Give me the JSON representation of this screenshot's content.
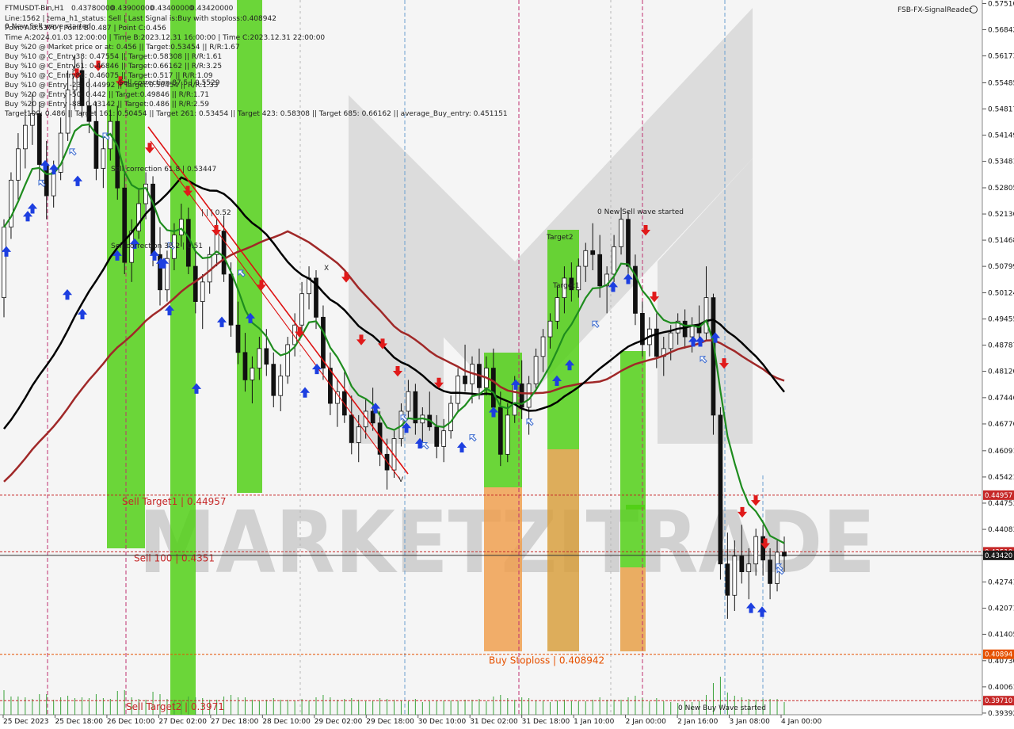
{
  "chart_data": {
    "type": "candlestick",
    "symbol": "FTMUSDT-Bin,H1",
    "ohlc_header": [
      "0.43780000",
      "0.43900000",
      "0.43400000",
      "0.43420000"
    ],
    "info_lines": [
      "Line:1562 | tema_h1_status: Sell | Last Signal is:Buy with stoploss:0.408942",
      "Point A:0.5370 | Point B:0.487 | Point C:0.456",
      "Time A:2024.01.03 12:00:00 | Time B:2023.12.31 16:00:00 | Time C:2023.12.31 22:00:00",
      "Buy %20 @ Market price or at: 0.456 || Target:0.53454 || R/R:1.67",
      "Buy %10 @ C_Entry38: 0.47554 || Target:0.58308 || R/R:1.61",
      "Buy %10 @ C_Entry61: 0.46846 || Target:0.66162 || R/R:3.25",
      "Buy %10 @ C_Entry88: 0.46075 || Target:0.517 || R/R:1.09",
      "Buy %10 @ Entry -23: 0.44992 || Target:0.50454 || R/R:1.33",
      "Buy %20 @ Entry -50: 0.442 || Target:0.49846 || R/R:1.71",
      "Buy %20 @ Entry -88: 0.43142 || Target:0.486 || R/R:2.59",
      "Target100: 0.486 || Target 161: 0.50454 || Target 261: 0.53454 || Target 423: 0.58308 || Target 685: 0.66162 || average_Buy_entry: 0.451151"
    ],
    "top_left_label": "0 New Sell wave started",
    "brand": "FSB-FX-SignalReader",
    "watermark": "MARKETZITRADE",
    "y_ticks": [
      "0.57510",
      "0.56842",
      "0.56173",
      "0.55485",
      "0.54817",
      "0.54149",
      "0.53481",
      "0.52805",
      "0.52136",
      "0.51468",
      "0.50799",
      "0.50124",
      "0.49455",
      "0.48787",
      "0.48120",
      "0.47446",
      "0.46776",
      "0.46091",
      "0.45421",
      "0.44753",
      "0.44083",
      "0.43415",
      "0.42741",
      "0.42071",
      "0.41405",
      "0.40730",
      "0.40061",
      "0.39392"
    ],
    "x_ticks": [
      "25 Dec 2023",
      "25 Dec 18:00",
      "26 Dec 10:00",
      "27 Dec 02:00",
      "27 Dec 18:00",
      "28 Dec 10:00",
      "29 Dec 02:00",
      "29 Dec 18:00",
      "30 Dec 10:00",
      "31 Dec 02:00",
      "31 Dec 18:00",
      "1 Jan 10:00",
      "2 Jan 00:00",
      "2 Jan 16:00",
      "3 Jan 08:00",
      "4 Jan 00:00"
    ],
    "ylim": [
      0.3935,
      0.576
    ],
    "levels": [
      {
        "label": "Sell Target1 | 0.44957",
        "tag": "0.44957",
        "value": 0.44957,
        "color": "#c62828"
      },
      {
        "label": "Sell 100 | 0.4351",
        "tag": "0.43510",
        "value": 0.4351,
        "color": "#c62828"
      },
      {
        "label": "Buy Stoploss | 0.408942",
        "tag": "0.40894",
        "value": 0.40894,
        "color": "#e65100"
      },
      {
        "label": "Sell Target2 | 0.3971",
        "tag": "0.39710",
        "value": 0.3971,
        "color": "#c62828"
      }
    ],
    "current_price": {
      "tag": "0.43420",
      "value": 0.4342
    },
    "annotations": [
      {
        "text": "Sell correction 61.8 | 0.53447",
        "value": 0.53447
      },
      {
        "text": "Sell correction 38.2 | 0.51"
      },
      {
        "text": "Sell correction 87.5 | 0.5529",
        "value": 0.5529
      },
      {
        "text": "| | | 0.52",
        "value": 0.52
      },
      {
        "text": "0 New Sell wave started"
      },
      {
        "text": "Target2"
      },
      {
        "text": "Target1"
      },
      {
        "text": "0 New Buy Wave started"
      },
      {
        "text": "V"
      }
    ],
    "series": [
      {
        "name": "red moving average",
        "color": "#a02828"
      },
      {
        "name": "black moving average",
        "color": "#000000"
      },
      {
        "name": "green moving average",
        "color": "#1e8c1e"
      }
    ],
    "candles": [
      [
        0.5,
        0.52,
        0.495,
        0.518
      ],
      [
        0.518,
        0.532,
        0.515,
        0.53
      ],
      [
        0.53,
        0.542,
        0.525,
        0.538
      ],
      [
        0.538,
        0.548,
        0.533,
        0.544
      ],
      [
        0.544,
        0.552,
        0.539,
        0.547
      ],
      [
        0.547,
        0.55,
        0.53,
        0.534
      ],
      [
        0.534,
        0.54,
        0.52,
        0.526
      ],
      [
        0.526,
        0.535,
        0.523,
        0.532
      ],
      [
        0.532,
        0.546,
        0.53,
        0.542
      ],
      [
        0.542,
        0.558,
        0.54,
        0.553
      ],
      [
        0.553,
        0.562,
        0.548,
        0.558
      ],
      [
        0.558,
        0.561,
        0.546,
        0.549
      ],
      [
        0.549,
        0.556,
        0.542,
        0.545
      ],
      [
        0.545,
        0.55,
        0.53,
        0.533
      ],
      [
        0.533,
        0.542,
        0.528,
        0.538
      ],
      [
        0.538,
        0.548,
        0.535,
        0.545
      ],
      [
        0.545,
        0.549,
        0.525,
        0.528
      ],
      [
        0.528,
        0.532,
        0.506,
        0.509
      ],
      [
        0.509,
        0.52,
        0.504,
        0.517
      ],
      [
        0.517,
        0.528,
        0.515,
        0.524
      ],
      [
        0.524,
        0.532,
        0.52,
        0.529
      ],
      [
        0.529,
        0.531,
        0.508,
        0.511
      ],
      [
        0.511,
        0.518,
        0.498,
        0.502
      ],
      [
        0.502,
        0.512,
        0.499,
        0.51
      ],
      [
        0.51,
        0.519,
        0.507,
        0.516
      ],
      [
        0.516,
        0.524,
        0.513,
        0.52
      ],
      [
        0.52,
        0.523,
        0.506,
        0.508
      ],
      [
        0.508,
        0.512,
        0.496,
        0.499
      ],
      [
        0.499,
        0.506,
        0.492,
        0.504
      ],
      [
        0.504,
        0.513,
        0.501,
        0.511
      ],
      [
        0.511,
        0.52,
        0.508,
        0.517
      ],
      [
        0.517,
        0.521,
        0.504,
        0.506
      ],
      [
        0.506,
        0.509,
        0.49,
        0.493
      ],
      [
        0.493,
        0.499,
        0.483,
        0.486
      ],
      [
        0.486,
        0.491,
        0.476,
        0.479
      ],
      [
        0.479,
        0.485,
        0.473,
        0.482
      ],
      [
        0.482,
        0.49,
        0.479,
        0.487
      ],
      [
        0.487,
        0.492,
        0.48,
        0.483
      ],
      [
        0.483,
        0.486,
        0.472,
        0.475
      ],
      [
        0.475,
        0.483,
        0.471,
        0.48
      ],
      [
        0.48,
        0.49,
        0.478,
        0.488
      ],
      [
        0.488,
        0.496,
        0.485,
        0.493
      ],
      [
        0.493,
        0.504,
        0.491,
        0.501
      ],
      [
        0.501,
        0.508,
        0.497,
        0.505
      ],
      [
        0.505,
        0.507,
        0.492,
        0.495
      ],
      [
        0.495,
        0.498,
        0.479,
        0.482
      ],
      [
        0.482,
        0.486,
        0.47,
        0.473
      ],
      [
        0.473,
        0.479,
        0.467,
        0.476
      ],
      [
        0.476,
        0.481,
        0.468,
        0.47
      ],
      [
        0.47,
        0.475,
        0.46,
        0.463
      ],
      [
        0.463,
        0.47,
        0.458,
        0.467
      ],
      [
        0.467,
        0.474,
        0.464,
        0.471
      ],
      [
        0.471,
        0.477,
        0.466,
        0.468
      ],
      [
        0.468,
        0.471,
        0.457,
        0.46
      ],
      [
        0.46,
        0.464,
        0.451,
        0.456
      ],
      [
        0.456,
        0.466,
        0.454,
        0.464
      ],
      [
        0.464,
        0.473,
        0.462,
        0.471
      ],
      [
        0.471,
        0.479,
        0.469,
        0.476
      ],
      [
        0.476,
        0.478,
        0.465,
        0.468
      ],
      [
        0.468,
        0.472,
        0.463,
        0.47
      ],
      [
        0.47,
        0.476,
        0.466,
        0.467
      ],
      [
        0.467,
        0.47,
        0.459,
        0.462
      ],
      [
        0.462,
        0.469,
        0.458,
        0.466
      ],
      [
        0.466,
        0.475,
        0.464,
        0.473
      ],
      [
        0.473,
        0.482,
        0.471,
        0.48
      ],
      [
        0.48,
        0.488,
        0.476,
        0.478
      ],
      [
        0.478,
        0.485,
        0.473,
        0.483
      ],
      [
        0.483,
        0.487,
        0.474,
        0.477
      ],
      [
        0.477,
        0.485,
        0.475,
        0.482
      ],
      [
        0.482,
        0.487,
        0.47,
        0.472
      ],
      [
        0.472,
        0.476,
        0.457,
        0.46
      ],
      [
        0.46,
        0.473,
        0.458,
        0.47
      ],
      [
        0.47,
        0.48,
        0.468,
        0.478
      ],
      [
        0.478,
        0.484,
        0.469,
        0.472
      ],
      [
        0.472,
        0.48,
        0.465,
        0.478
      ],
      [
        0.478,
        0.487,
        0.476,
        0.485
      ],
      [
        0.485,
        0.492,
        0.481,
        0.49
      ],
      [
        0.49,
        0.496,
        0.487,
        0.494
      ],
      [
        0.494,
        0.503,
        0.492,
        0.5
      ],
      [
        0.5,
        0.508,
        0.496,
        0.505
      ],
      [
        0.505,
        0.509,
        0.499,
        0.502
      ],
      [
        0.502,
        0.51,
        0.5,
        0.508
      ],
      [
        0.508,
        0.514,
        0.504,
        0.512
      ],
      [
        0.512,
        0.519,
        0.507,
        0.511
      ],
      [
        0.511,
        0.516,
        0.5,
        0.503
      ],
      [
        0.503,
        0.508,
        0.496,
        0.506
      ],
      [
        0.506,
        0.516,
        0.504,
        0.513
      ],
      [
        0.513,
        0.523,
        0.511,
        0.52
      ],
      [
        0.52,
        0.522,
        0.506,
        0.508
      ],
      [
        0.508,
        0.511,
        0.493,
        0.496
      ],
      [
        0.496,
        0.499,
        0.485,
        0.488
      ],
      [
        0.488,
        0.495,
        0.485,
        0.492
      ],
      [
        0.492,
        0.496,
        0.482,
        0.485
      ],
      [
        0.485,
        0.49,
        0.48,
        0.487
      ],
      [
        0.487,
        0.493,
        0.484,
        0.491
      ],
      [
        0.491,
        0.496,
        0.488,
        0.494
      ],
      [
        0.494,
        0.497,
        0.487,
        0.49
      ],
      [
        0.49,
        0.495,
        0.486,
        0.493
      ],
      [
        0.493,
        0.498,
        0.488,
        0.491
      ],
      [
        0.491,
        0.508,
        0.489,
        0.5
      ],
      [
        0.5,
        0.501,
        0.465,
        0.47
      ],
      [
        0.47,
        0.472,
        0.428,
        0.432
      ],
      [
        0.432,
        0.44,
        0.418,
        0.424
      ],
      [
        0.424,
        0.438,
        0.42,
        0.434
      ],
      [
        0.434,
        0.442,
        0.427,
        0.43
      ],
      [
        0.43,
        0.436,
        0.423,
        0.432
      ],
      [
        0.432,
        0.441,
        0.429,
        0.439
      ],
      [
        0.439,
        0.442,
        0.429,
        0.433
      ],
      [
        0.433,
        0.436,
        0.423,
        0.427
      ],
      [
        0.427,
        0.438,
        0.425,
        0.435
      ],
      [
        0.435,
        0.439,
        0.43,
        0.434
      ]
    ],
    "buy_arrows": [
      [
        8,
        0.513
      ],
      [
        35,
        0.522
      ],
      [
        41,
        0.524
      ],
      [
        57,
        0.535
      ],
      [
        68,
        0.534
      ],
      [
        98,
        0.531
      ],
      [
        85,
        0.502
      ],
      [
        104,
        0.497
      ],
      [
        148,
        0.512
      ],
      [
        170,
        0.515
      ],
      [
        195,
        0.512
      ],
      [
        203,
        0.51
      ],
      [
        207,
        0.51
      ],
      [
        214,
        0.498
      ],
      [
        248,
        0.478
      ],
      [
        280,
        0.495
      ],
      [
        316,
        0.496
      ],
      [
        385,
        0.477
      ],
      [
        400,
        0.483
      ],
      [
        474,
        0.473
      ],
      [
        513,
        0.468
      ],
      [
        530,
        0.464
      ],
      [
        583,
        0.463
      ],
      [
        623,
        0.472
      ],
      [
        651,
        0.479
      ],
      [
        703,
        0.48
      ],
      [
        719,
        0.484
      ],
      [
        774,
        0.504
      ],
      [
        793,
        0.506
      ],
      [
        875,
        0.49
      ],
      [
        884,
        0.49
      ],
      [
        903,
        0.491
      ],
      [
        948,
        0.422
      ],
      [
        962,
        0.421
      ]
    ],
    "sell_arrows": [
      [
        97,
        0.556
      ],
      [
        124,
        0.558
      ],
      [
        152,
        0.554
      ],
      [
        189,
        0.537
      ],
      [
        237,
        0.526
      ],
      [
        273,
        0.516
      ],
      [
        330,
        0.502
      ],
      [
        378,
        0.49
      ],
      [
        437,
        0.504
      ],
      [
        456,
        0.488
      ],
      [
        483,
        0.487
      ],
      [
        502,
        0.48
      ],
      [
        554,
        0.477
      ],
      [
        815,
        0.516
      ],
      [
        826,
        0.499
      ],
      [
        914,
        0.482
      ],
      [
        937,
        0.444
      ],
      [
        954,
        0.447
      ],
      [
        966,
        0.436
      ]
    ],
    "hollow_arrows": [
      [
        49,
        0.53
      ],
      [
        88,
        0.538
      ],
      [
        130,
        0.542
      ],
      [
        533,
        0.463
      ],
      [
        593,
        0.465
      ],
      [
        665,
        0.469
      ],
      [
        748,
        0.494
      ],
      [
        884,
        0.485
      ],
      [
        981,
        0.431
      ],
      [
        212,
        0.514
      ],
      [
        301,
        0.507
      ],
      [
        506,
        0.47
      ],
      [
        980,
        0.432
      ]
    ]
  }
}
